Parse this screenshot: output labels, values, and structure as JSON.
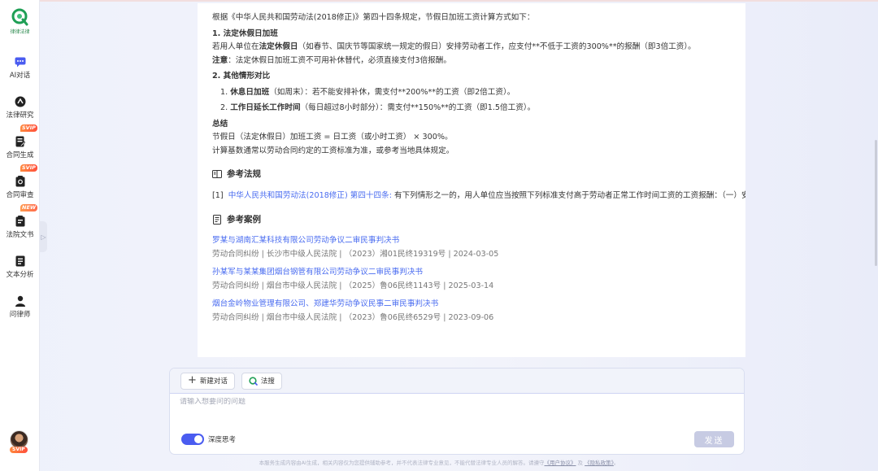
{
  "brand": {
    "logo_text": "律律法律"
  },
  "sidebar": {
    "items": [
      {
        "label": "AI对话",
        "badge": ""
      },
      {
        "label": "法律研究",
        "badge": ""
      },
      {
        "label": "合同生成",
        "badge": "SVIP"
      },
      {
        "label": "合同审查",
        "badge": "SVIP"
      },
      {
        "label": "法院文书",
        "badge": "NEW"
      },
      {
        "label": "文本分析",
        "badge": ""
      },
      {
        "label": "问律师",
        "badge": ""
      }
    ],
    "avatar_badge": "SVIP"
  },
  "answer": {
    "intro": "根据《中华人民共和国劳动法(2018修正)》第四十四条规定，节假日加班工资计算方式如下：",
    "h1": "1. 法定休假日加班",
    "p1_pre": "若用人单位在",
    "p1_bold": "法定休假日",
    "p1_post": "（如春节、国庆节等国家统一规定的假日）安排劳动者工作，应支付**不低于工资的300%**的报酬（即3倍工资）。",
    "note_label": "注意",
    "note_text": "：法定休假日加班工资不可用补休替代，必须直接支付3倍报酬。",
    "h2": "2. 其他情形对比",
    "item1_num": "1.",
    "item1_bold": "休息日加班",
    "item1_text": "（如周末）：若不能安排补休，需支付**200%**的工资（即2倍工资）。",
    "item2_num": "2.",
    "item2_bold": "工作日延长工作时间",
    "item2_text": "（每日超过8小时部分）：需支付**150%**的工资（即1.5倍工资）。",
    "summary_title": "总结",
    "summary_line1": "节假日（法定休假日）加班工资 = 日工资（或小时工资） × 300%。",
    "summary_line2": "计算基数通常以劳动合同约定的工资标准为准，或参考当地具体规定。"
  },
  "references": {
    "title": "参考法规",
    "items": [
      {
        "index": "[1]",
        "link": "中华人民共和国劳动法(2018修正) 第四十四条:",
        "text": " 有下列情形之一的，用人单位应当按照下列标准支付高于劳动者正常工作时间工资的工资报酬：（一）安排劳动者延长工作时间的，支付不低于工资的百分之一百五十的工资报酬；（二）休息日安排劳动者工作又不能安排补休的，支付不低于工资的百分之二百的工资报酬；（三）法定休假日安排劳动者工作的，支付不低于工资的百分之三百的工资报酬。"
      }
    ]
  },
  "cases": {
    "title": "参考案例",
    "items": [
      {
        "title": "罗某与湖南汇某科技有限公司劳动争议二审民事判决书",
        "meta": "劳动合同纠纷 | 长沙市中级人民法院 | （2023）湘01民终19319号 | 2024-03-05"
      },
      {
        "title": "孙某军与某某集团烟台钢管有限公司劳动争议二审民事判决书",
        "meta": "劳动合同纠纷 | 烟台市中级人民法院 | （2025）鲁06民终1143号 | 2025-03-14"
      },
      {
        "title": "烟台金岭物业管理有限公司、郑建华劳动争议民事二审民事判决书",
        "meta": "劳动合同纠纷 | 烟台市中级人民法院 | （2023）鲁06民终6529号 | 2023-09-06"
      }
    ]
  },
  "chat": {
    "new_chat": "新建对话",
    "law_search": "法搜",
    "placeholder": "请输入想要问的问题",
    "deep_think": "深度思考",
    "send": "发送"
  },
  "footer": {
    "text": "本服务生成内容由AI生成，相关内容仅为您提供辅助参考，并不代表法律专业意见，不能代替法律专业人员的解答。请遵守",
    "link1": "《用户协议》",
    "and": " 及 ",
    "link2": "《隐私政策》",
    "end": "。"
  },
  "colors": {
    "accent": "#4a6cf0",
    "brand_green": "#2c8a4f",
    "badge": "#ff5a3d"
  }
}
